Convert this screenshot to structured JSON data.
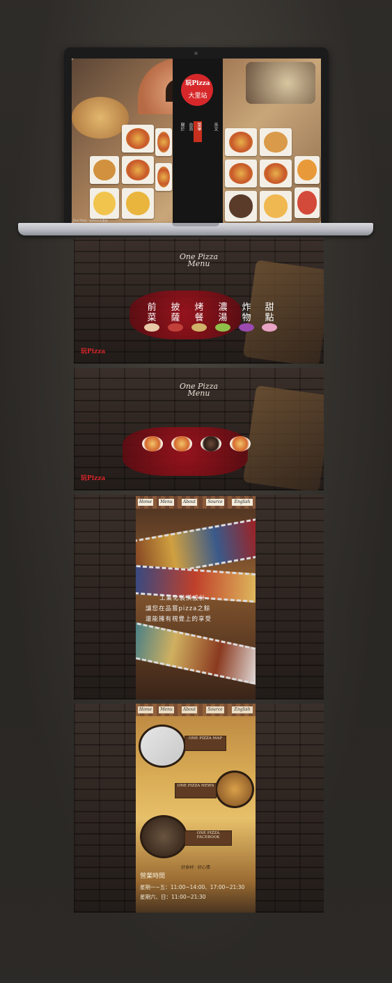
{
  "desktop": {
    "logo_brand": "玩Pizza",
    "logo_branch": "大里站",
    "nav": [
      "英文",
      "菜單",
      "首頁",
      "關於"
    ],
    "caption": "One Pizza - 玩Pizza大里站"
  },
  "menu_panel": {
    "title_line1": "One Pizza",
    "title_line2": "Menu",
    "categories": [
      "前菜",
      "披薩",
      "烤餐",
      "濃湯",
      "炸物",
      "甜點"
    ],
    "side_logo": "玩Pizza"
  },
  "pizza_panel": {
    "title_line1": "One Pizza",
    "title_line2": "Menu",
    "side_logo": "玩Pizza"
  },
  "mobile_about": {
    "nav": [
      "Home",
      "Menu",
      "About",
      "Source",
      "English"
    ],
    "slogan": [
      "工業化裝潢設計",
      "讓您在品嘗pizza之餘",
      "還能擁有視覺上的享受"
    ]
  },
  "mobile_contact": {
    "nav": [
      "Home",
      "Menu",
      "About",
      "Source",
      "English"
    ],
    "labels": [
      "ONE PIZZA MAP",
      "ONE PIZZA NEWS",
      "ONE PIZZA FACEBOOK"
    ],
    "tagline": "好食材 · 好心情",
    "hours_title": "營業時間",
    "hours_weekday": "星期一~五：11:00~14:00、17:00~21:30",
    "hours_weekend": "星期六、日：11:00~21:30"
  },
  "colors": {
    "brand_red": "#d6282a",
    "dark": "#151515"
  }
}
